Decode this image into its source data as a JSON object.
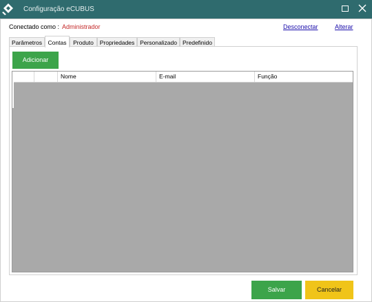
{
  "window": {
    "title": "Configuração eCUBUS"
  },
  "connection": {
    "label": "Conectado como :",
    "user": "Administrador",
    "disconnect": "Desconectar",
    "change": "Alterar"
  },
  "tabs": [
    {
      "label": "Parâmetros"
    },
    {
      "label": "Contas"
    },
    {
      "label": "Produto"
    },
    {
      "label": "Propriedades"
    },
    {
      "label": "Personalizado"
    },
    {
      "label": "Predefinido"
    }
  ],
  "active_tab": "Contas",
  "toolbar": {
    "add_label": "Adicionar"
  },
  "table": {
    "columns": [
      "",
      "",
      "Nome",
      "E-mail",
      "Função"
    ]
  },
  "footer": {
    "save_label": "Salvar",
    "cancel_label": "Cancelar"
  },
  "colors": {
    "titlebar": "#2f6b6e",
    "primary_green": "#3ca44a",
    "cancel_yellow": "#f0c419",
    "user_red": "#c42a2a",
    "link_blue": "#1a0dab",
    "grid_bg": "#a9a9a9"
  }
}
